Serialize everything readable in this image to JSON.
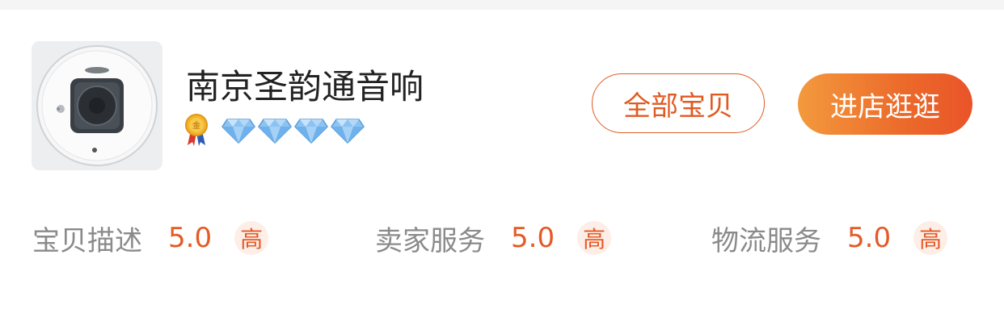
{
  "shop": {
    "name": "南京圣韵通音响",
    "medal_icon": "gold-medal-icon",
    "medal_glyph": "金",
    "diamond_count": 4,
    "diamond_icon": "diamond-icon"
  },
  "buttons": {
    "all_items": "全部宝贝",
    "enter_shop": "进店逛逛"
  },
  "colors": {
    "accent": "#e45a26",
    "button_gradient_start": "#f39a3d",
    "button_gradient_end": "#e9542a",
    "diamond": "#7fb7ec"
  },
  "ratings": [
    {
      "label": "宝贝描述",
      "score": "5.0",
      "level": "高"
    },
    {
      "label": "卖家服务",
      "score": "5.0",
      "level": "高"
    },
    {
      "label": "物流服务",
      "score": "5.0",
      "level": "高"
    }
  ]
}
